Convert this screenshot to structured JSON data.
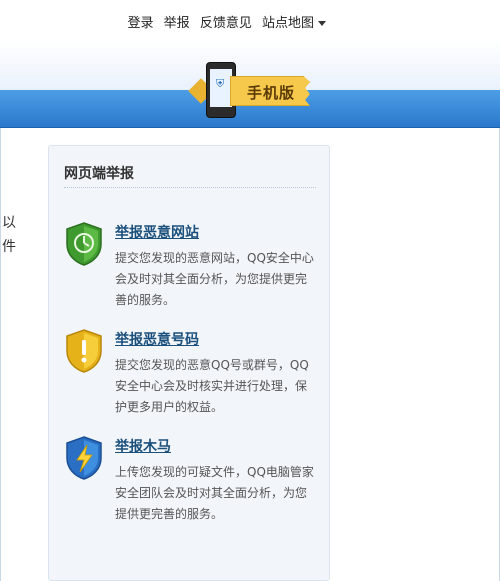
{
  "topnav": {
    "login": "登录",
    "report": "举报",
    "feedback": "反馈意见",
    "sitemap": "站点地图"
  },
  "mobile_badge": {
    "label": "手机版"
  },
  "left_fragments": [
    "以",
    "件"
  ],
  "panel": {
    "title": "网页端举报",
    "items": [
      {
        "title": "举报恶意网站",
        "desc": "提交您发现的恶意网站，QQ安全中心会及时对其全面分析，为您提供更完善的服务。",
        "icon": "green-shield-clock-icon",
        "color": "#3f9a2f"
      },
      {
        "title": "举报恶意号码",
        "desc": "提交您发现的恶意QQ号或群号，QQ安全中心会及时核实并进行处理，保护更多用户的权益。",
        "icon": "yellow-shield-exclamation-icon",
        "color": "#e6b21a"
      },
      {
        "title": "举报木马",
        "desc": "上传您发现的可疑文件，QQ电脑管家安全团队会及时对其全面分析，为您提供更完善的服务。",
        "icon": "blue-shield-lightning-icon",
        "color": "#2a6fc4"
      }
    ]
  }
}
